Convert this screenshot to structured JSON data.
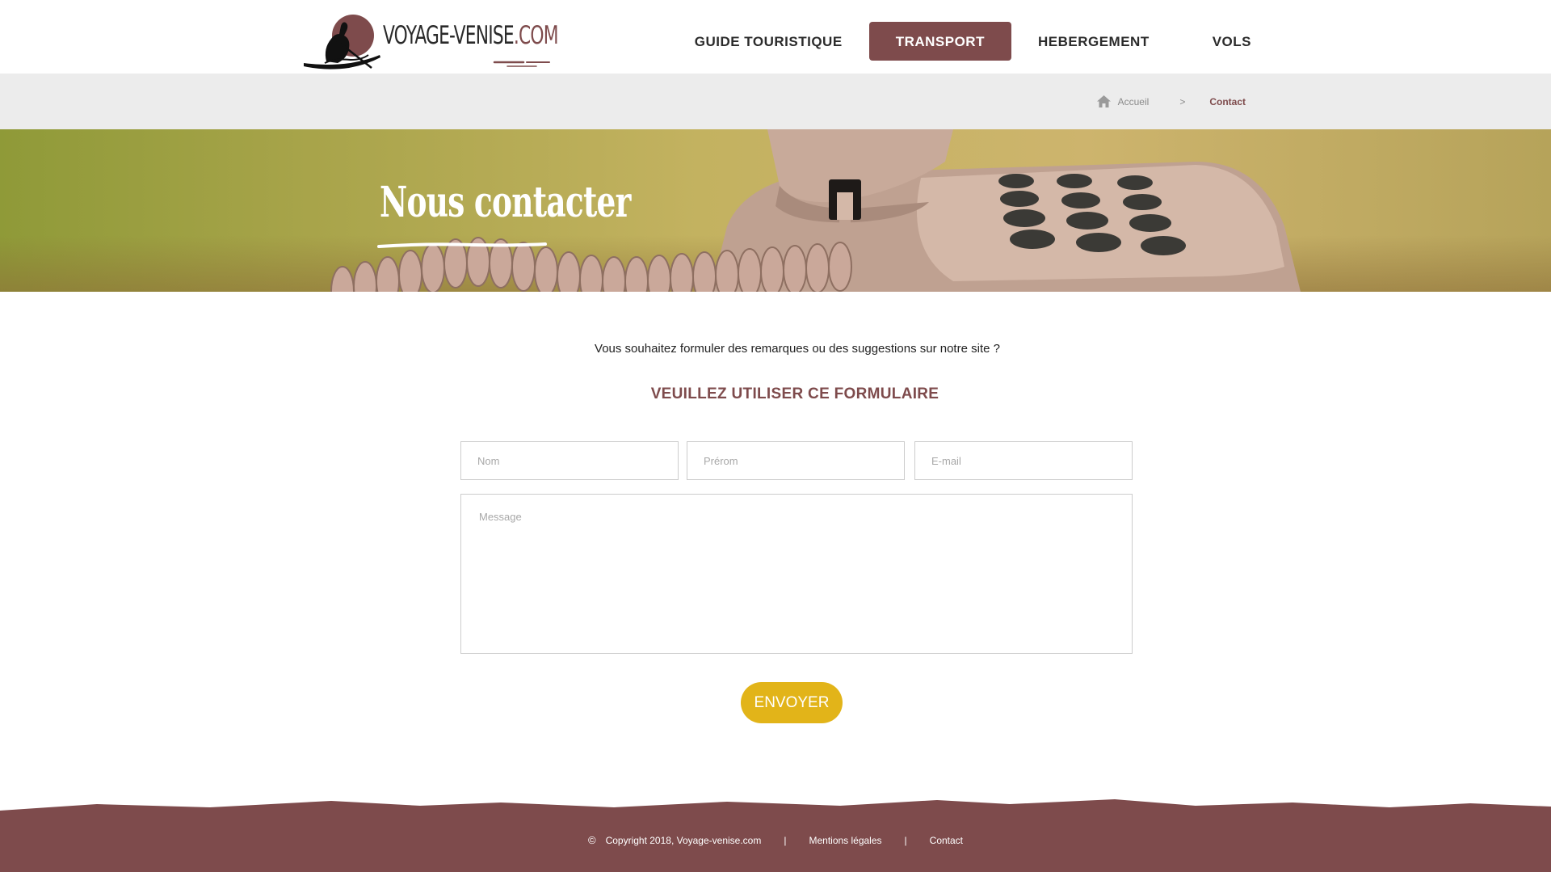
{
  "site": {
    "logo_text": "VOYAGE-VENISE",
    "logo_suffix": ".COM"
  },
  "nav": {
    "items": [
      {
        "label": "GUIDE TOURISTIQUE"
      },
      {
        "label": "TRANSPORT"
      },
      {
        "label": "HEBERGEMENT"
      },
      {
        "label": "VOLS"
      }
    ],
    "active": "TRANSPORT"
  },
  "breadcrumb": {
    "home_label": "Accueil",
    "separator": ">",
    "current": "Contact"
  },
  "hero": {
    "title": "Nous contacter"
  },
  "content": {
    "intro": "Vous souhaitez formuler des remarques ou des suggestions sur notre site ?",
    "form_title": "VEUILLEZ UTILISER CE FORMULAIRE"
  },
  "form": {
    "nom_placeholder": "Nom",
    "prenom_placeholder": "Prérom",
    "email_placeholder": "E-mail",
    "message_placeholder": "Message",
    "submit_label": "ENVOYER"
  },
  "footer": {
    "copyright_symbol": "©",
    "copyright": "Copyright 2018, Voyage-venise.com",
    "separator": "|",
    "legal": "Mentions légales",
    "contact": "Contact"
  },
  "colors": {
    "brand": "#7e4b4c",
    "accent_button": "#e2b419",
    "crumb_bar": "#ececec"
  }
}
